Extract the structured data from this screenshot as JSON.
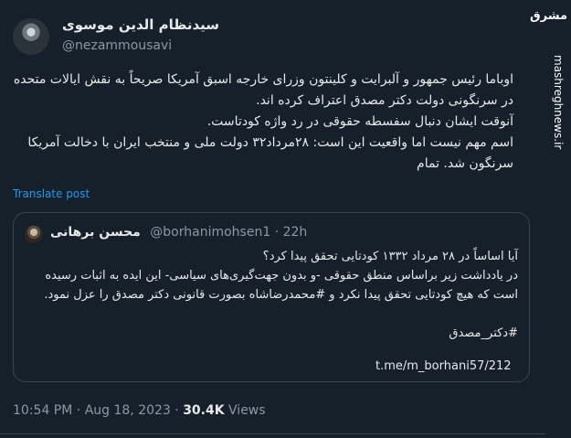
{
  "author": {
    "display_name": "سیدنظام الدین موسوی",
    "handle": "@nezammousavi"
  },
  "post": {
    "paragraphs": [
      "اوباما رئیس جمهور و آلبرایت و کلینتون وزرای خارجه اسبق آمریکا صریحاً به نقش ایالات متحده در سرنگونی دولت دکتر مصدق اعتراف کرده اند.",
      "آنوقت ایشان دنبال سفسطه حقوقی در رد واژه کودتاست.",
      "اسم مهم نیست اما واقعیت این است: ۲۸مرداد۳۲ دولت ملی و منتخب ایران با دخالت آمریکا سرنگون شد. تمام"
    ],
    "translate_label": "Translate post",
    "time": "10:54 PM",
    "date": "Aug 18, 2023",
    "separator": "·",
    "views_count": "30.4K",
    "views_label": "Views"
  },
  "quoted": {
    "display_name": "محسن برهانی",
    "handle": "@borhanimohsen1",
    "separator": "·",
    "age": "22h",
    "line1": "آیا اساساً در ۲۸ مرداد ۱۳۳۲ کودتایی تحقق پیدا کرد؟",
    "line2": "در یادداشت زیر براساس منطق حقوقی -و بدون جهت‌گیری‌های سیاسی- این ایده به اثبات رسیده است که هیچ کودتایی تحقق پیدا نکرد و #محمدرضاشاه بصورت قانونی دکتر مصدق را عزل نمود.",
    "hashtag": "#دکتر_مصدق",
    "link": "t.me/m_borhani57/212"
  },
  "watermark": {
    "logo": "مشرق",
    "url": "mashreghnews.ir"
  }
}
